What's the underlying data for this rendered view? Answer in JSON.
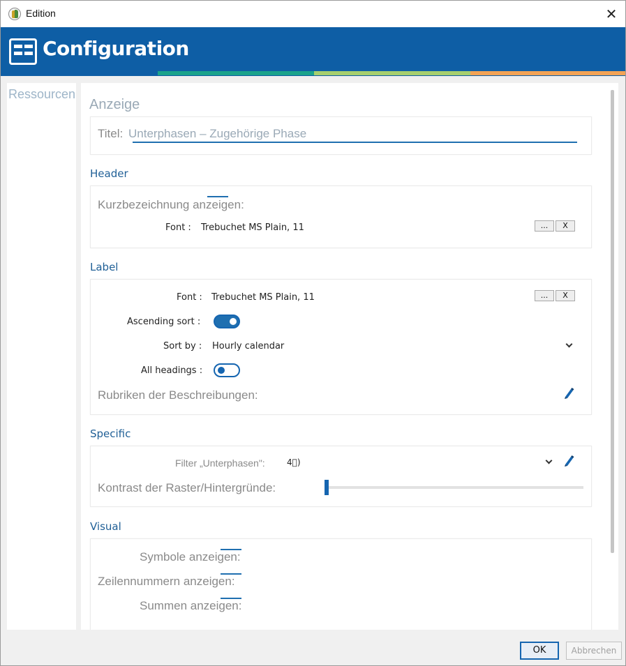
{
  "window": {
    "title": "Edition",
    "close_glyph": "✕"
  },
  "banner": {
    "title": "Configuration",
    "icon": "table-grid-icon",
    "accent_colors": [
      "#0e5ea5",
      "#1aa38c",
      "#a6cf6e",
      "#f2a356"
    ]
  },
  "sidebar": {
    "items": [
      {
        "label": "Ressourcen"
      }
    ]
  },
  "anzeige": {
    "heading": "Anzeige",
    "title_label": "Titel:",
    "title_value": "Unterphasen – Zugehörige Phase"
  },
  "header_section": {
    "heading": "Header",
    "short_name_label": "Kurzbezeichnung anzeigen:",
    "font_label": "Font :",
    "font_value": "Trebuchet MS Plain, 11",
    "browse_label": "...",
    "clear_label": "X"
  },
  "label_section": {
    "heading": "Label",
    "font_label": "Font :",
    "font_value": "Trebuchet MS Plain, 11",
    "browse_label": "...",
    "clear_label": "X",
    "ascending_label": "Ascending sort :",
    "sort_by_label": "Sort by :",
    "sort_by_value": "Hourly calendar",
    "all_headings_label": "All headings :",
    "rubriken_label": "Rubriken der Beschreibungen:"
  },
  "specific_section": {
    "heading": "Specific",
    "filter_label": "Filter „Unterphasen\":",
    "filter_value": "4⃞)",
    "contrast_label": "Kontrast der Raster/Hintergründe:",
    "contrast_level": 0
  },
  "visual_section": {
    "heading": "Visual",
    "symbols_label": "Symbole anzeigen:",
    "line_numbers_label": "Zeilennummern anzeigen:",
    "sums_label": "Summen anzeigen:"
  },
  "footer": {
    "ok_label": "OK",
    "cancel_label": "Abbrechen"
  }
}
